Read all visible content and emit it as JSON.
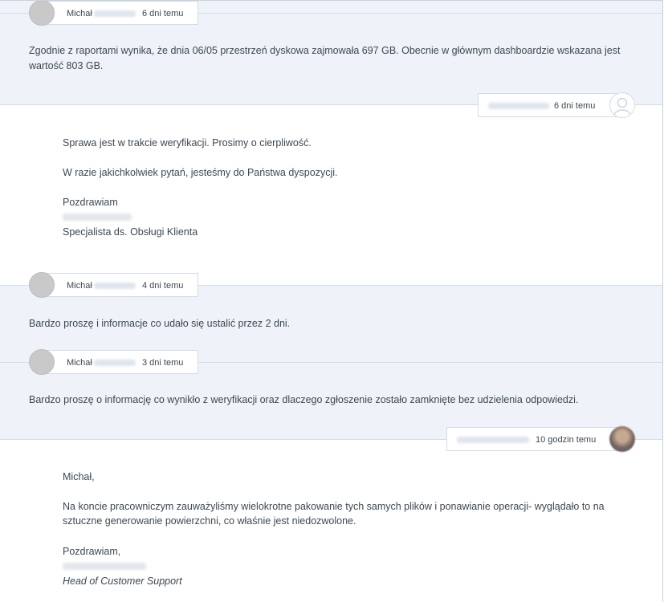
{
  "messages": [
    {
      "author": "Michał",
      "time": "6 dni temu",
      "text": "Zgodnie z raportami wynika, że dnia 06/05 przestrzeń dyskowa zajmowała 697 GB. Obecnie w głównym dashboardzie wskazana jest",
      "text2": "wartość 803 GB."
    },
    {
      "time": "6 dni temu",
      "lines": [
        "Sprawa jest w trakcie weryfikacji. Prosimy o cierpliwość.",
        "W razie jakichkolwiek pytań, jesteśmy do Państwa dyspozycji.",
        "Pozdrawiam",
        "Specjalista ds. Obsługi Klienta"
      ]
    },
    {
      "author": "Michał",
      "time": "4 dni temu",
      "text": "Bardzo proszę i informacje co udało się ustalić przez 2 dni."
    },
    {
      "author": "Michał",
      "time": "3 dni temu",
      "text": "Bardzo proszę o informację co wynikło z weryfikacji oraz dlaczego zgłoszenie zostało zamknięte bez udzielenia odpowiedzi."
    },
    {
      "time": "10 godzin temu",
      "lines": [
        "Michał,",
        "Na koncie pracowniczym zauważyliśmy wielokrotne pakowanie tych samych plików i ponawianie operacji- wyglądało to na",
        "sztuczne generowanie powierzchni, co właśnie jest niedozwolone.",
        "Pozdrawiam,",
        "Head of Customer Support"
      ]
    }
  ]
}
